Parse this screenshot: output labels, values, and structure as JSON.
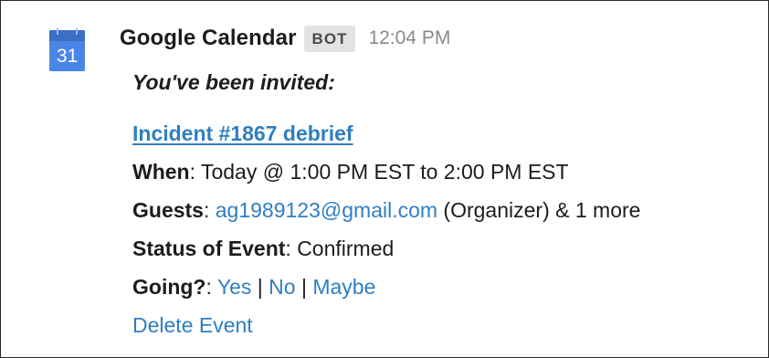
{
  "message": {
    "sender": "Google Calendar",
    "badge": "BOT",
    "time": "12:04 PM",
    "avatar_icon": "google-calendar-icon",
    "avatar_day": "31",
    "intro": "You've been invited:"
  },
  "event": {
    "title": "Incident #1867 debrief",
    "when_label": "When",
    "when_value": ": Today @ 1:00 PM EST to 2:00 PM EST",
    "guests_label": "Guests",
    "guests_sep": ": ",
    "guest_email": "ag1989123@gmail.com",
    "guests_rest": " (Organizer) & 1 more",
    "status_label": "Status of Event",
    "status_value": ": Confirmed",
    "going_label": "Going?",
    "going_sep": ": ",
    "rsvp_yes": "Yes",
    "rsvp_no": "No",
    "rsvp_maybe": "Maybe",
    "rsvp_divider": " | ",
    "delete_label": "Delete Event"
  },
  "colors": {
    "link": "#2f7ec2",
    "calendar_blue": "#4a86e8",
    "calendar_dark_blue": "#3b6fc4",
    "timestamp": "#8a8a8a",
    "badge_bg": "#e3e3e3"
  }
}
